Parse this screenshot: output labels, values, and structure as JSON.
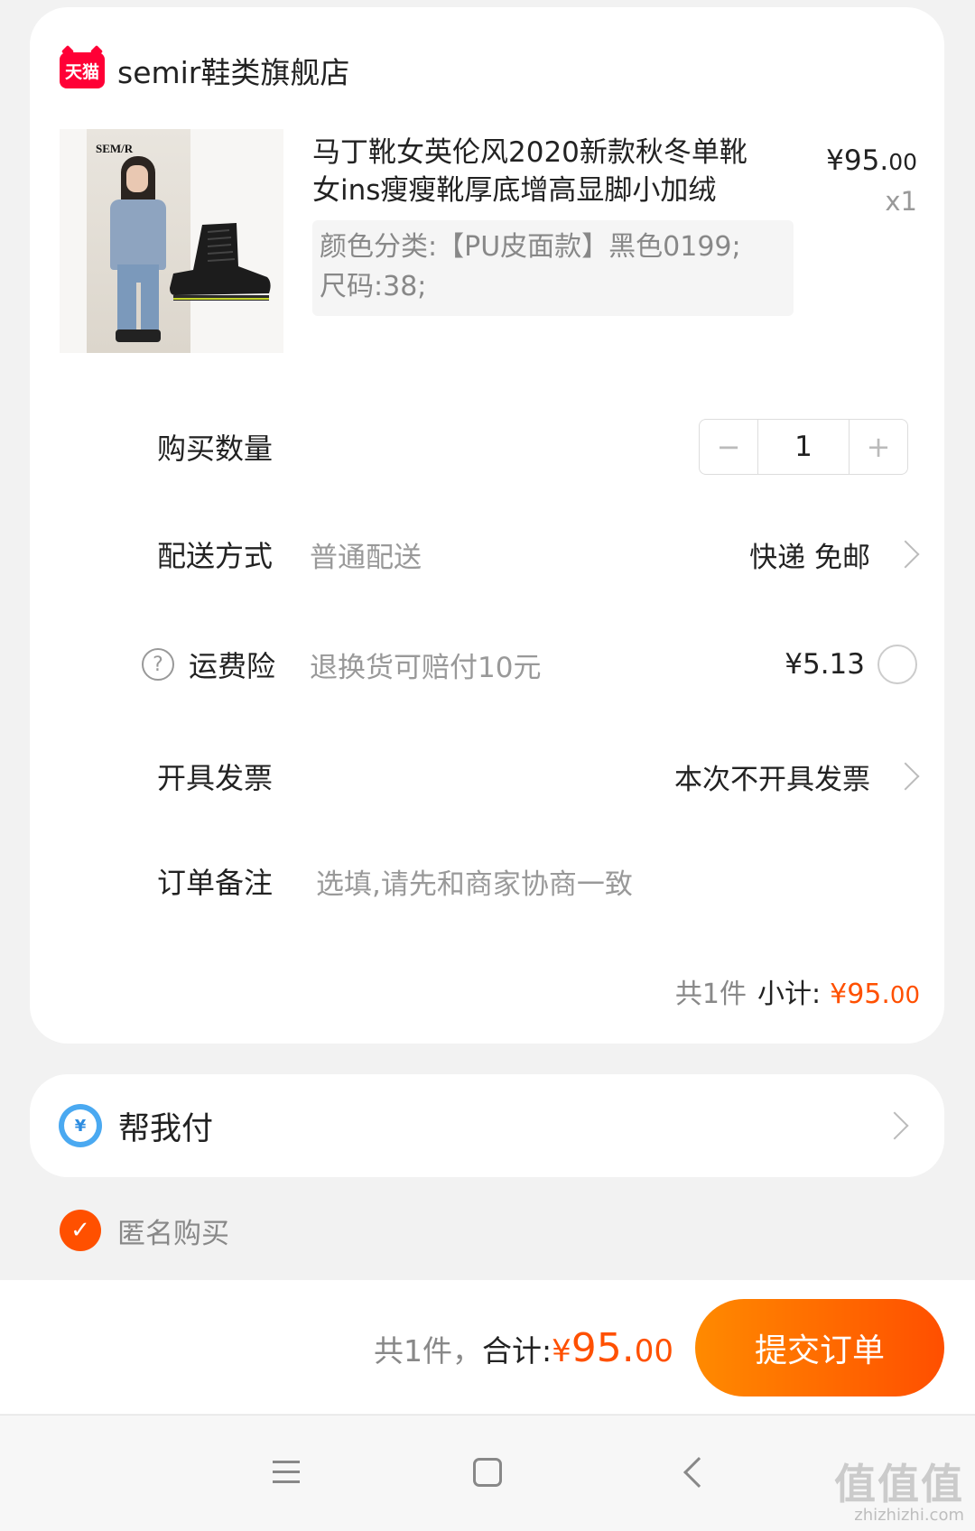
{
  "shop": {
    "badge": "天猫",
    "name": "semir鞋类旗舰店"
  },
  "product": {
    "image_brand": "SEM/R",
    "title": "马丁靴女英伦风2020新款秋冬单靴女ins瘦瘦靴厚底增高显脚小加绒",
    "price_int": "¥95.",
    "price_dec": "00",
    "qty": "x1",
    "sku_line1": "颜色分类:【PU皮面款】黑色0199;",
    "sku_line2": "尺码:38;"
  },
  "quantity": {
    "label": "购买数量",
    "minus": "−",
    "value": "1",
    "plus": "+"
  },
  "delivery": {
    "label": "配送方式",
    "sub": "普通配送",
    "value": "快递 免邮"
  },
  "insurance": {
    "help": "?",
    "label": "运费险",
    "sub": "退换货可赔付10元",
    "price": "¥5.13",
    "selected": false
  },
  "invoice": {
    "label": "开具发票",
    "value": "本次不开具发票"
  },
  "remark": {
    "label": "订单备注",
    "placeholder": "选填,请先和商家协商一致"
  },
  "subtotal": {
    "count": "共1件",
    "label": "小计:",
    "amount_int": "¥95.",
    "amount_dec": "00"
  },
  "pay_help": {
    "label": "帮我付",
    "icon_text": "¥"
  },
  "anonymous": {
    "label": "匿名购买",
    "checked": true,
    "check_mark": "✓"
  },
  "footer": {
    "count": "共1件，",
    "label": "合计:",
    "yen": "¥",
    "amount_int": "95.",
    "amount_dec": "00",
    "submit": "提交订单"
  },
  "watermark": {
    "text": "值值值",
    "url": "zhizhizhi.com"
  },
  "colors": {
    "accent": "#ff5000",
    "tmall_red": "#ff0036",
    "pay_blue": "#4aa9f1"
  }
}
